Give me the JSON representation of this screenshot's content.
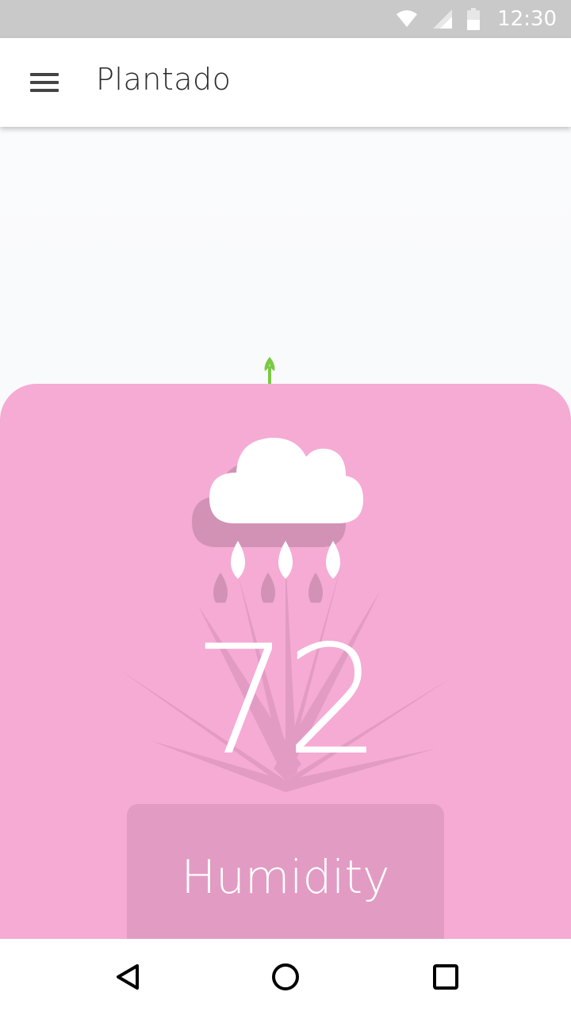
{
  "status_bar": {
    "time": "12:30",
    "icons": [
      "wifi-icon",
      "signal-icon",
      "battery-icon"
    ]
  },
  "app_bar": {
    "title": "Plantado",
    "menu_icon": "hamburger-menu-icon"
  },
  "card": {
    "icon": "rain-cloud-icon",
    "value": "72",
    "label": "Humidity",
    "background_color": "#f5abd4"
  },
  "nav_bar": {
    "icons": [
      "back-icon",
      "home-icon",
      "recents-icon"
    ]
  },
  "colors": {
    "status_bar": "#c9c9c9",
    "app_bar": "#ffffff",
    "accent_pink": "#f5abd4",
    "sprout_green": "#7ac943"
  }
}
